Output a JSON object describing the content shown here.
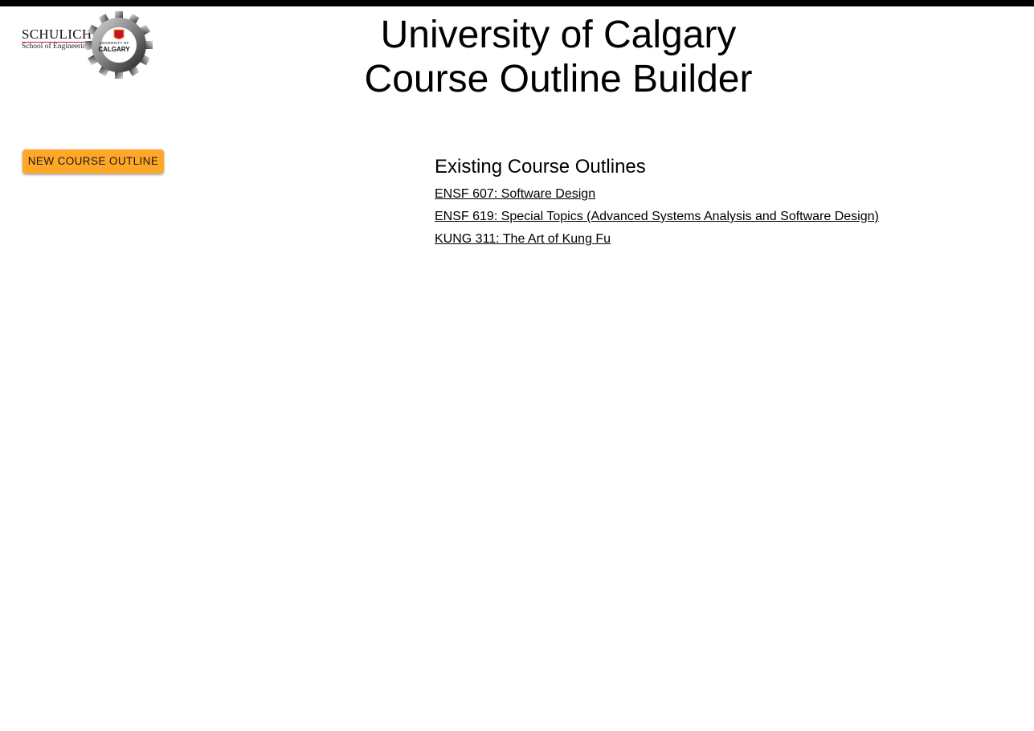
{
  "header": {
    "logo": {
      "school_name": "SCHULICH",
      "school_subtitle": "School of Engineering",
      "uc_small": "UNIVERSITY OF",
      "uc_big": "CALGARY",
      "icon": "gear-logo-icon"
    },
    "title_line1": "University of Calgary",
    "title_line2": "Course Outline Builder"
  },
  "actions": {
    "new_outline_label": "NEW COURSE OUTLINE"
  },
  "existing": {
    "heading": "Existing Course Outlines",
    "outlines": [
      "ENSF 607: Software Design",
      "ENSF 619: Special Topics (Advanced Systems Analysis and Software Design)",
      "KUNG 311: The Art of Kung Fu"
    ]
  },
  "colors": {
    "accent": "#ffa726",
    "topbar": "#000000",
    "brand_red": "#c8102e"
  }
}
